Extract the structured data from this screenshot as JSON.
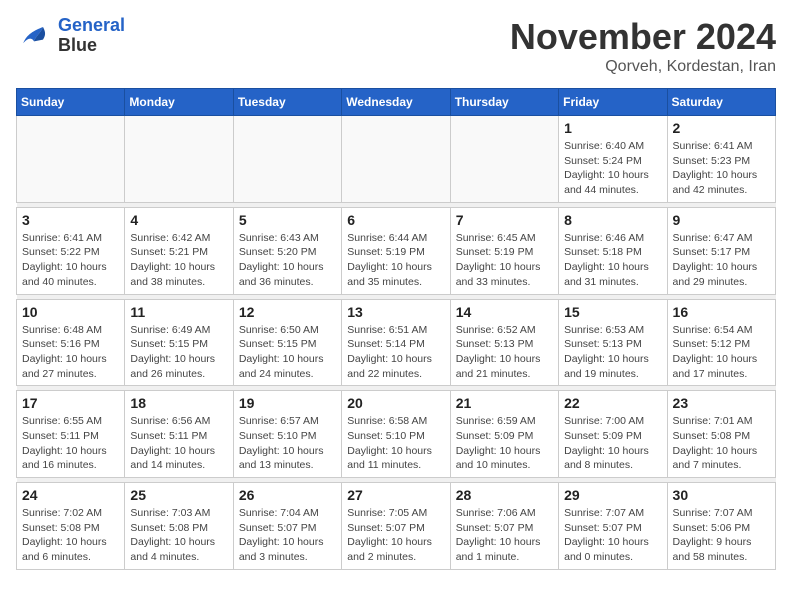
{
  "header": {
    "logo_line1": "General",
    "logo_line2": "Blue",
    "month": "November 2024",
    "location": "Qorveh, Kordestan, Iran"
  },
  "weekdays": [
    "Sunday",
    "Monday",
    "Tuesday",
    "Wednesday",
    "Thursday",
    "Friday",
    "Saturday"
  ],
  "weeks": [
    [
      {
        "day": "",
        "info": ""
      },
      {
        "day": "",
        "info": ""
      },
      {
        "day": "",
        "info": ""
      },
      {
        "day": "",
        "info": ""
      },
      {
        "day": "",
        "info": ""
      },
      {
        "day": "1",
        "info": "Sunrise: 6:40 AM\nSunset: 5:24 PM\nDaylight: 10 hours\nand 44 minutes."
      },
      {
        "day": "2",
        "info": "Sunrise: 6:41 AM\nSunset: 5:23 PM\nDaylight: 10 hours\nand 42 minutes."
      }
    ],
    [
      {
        "day": "3",
        "info": "Sunrise: 6:41 AM\nSunset: 5:22 PM\nDaylight: 10 hours\nand 40 minutes."
      },
      {
        "day": "4",
        "info": "Sunrise: 6:42 AM\nSunset: 5:21 PM\nDaylight: 10 hours\nand 38 minutes."
      },
      {
        "day": "5",
        "info": "Sunrise: 6:43 AM\nSunset: 5:20 PM\nDaylight: 10 hours\nand 36 minutes."
      },
      {
        "day": "6",
        "info": "Sunrise: 6:44 AM\nSunset: 5:19 PM\nDaylight: 10 hours\nand 35 minutes."
      },
      {
        "day": "7",
        "info": "Sunrise: 6:45 AM\nSunset: 5:19 PM\nDaylight: 10 hours\nand 33 minutes."
      },
      {
        "day": "8",
        "info": "Sunrise: 6:46 AM\nSunset: 5:18 PM\nDaylight: 10 hours\nand 31 minutes."
      },
      {
        "day": "9",
        "info": "Sunrise: 6:47 AM\nSunset: 5:17 PM\nDaylight: 10 hours\nand 29 minutes."
      }
    ],
    [
      {
        "day": "10",
        "info": "Sunrise: 6:48 AM\nSunset: 5:16 PM\nDaylight: 10 hours\nand 27 minutes."
      },
      {
        "day": "11",
        "info": "Sunrise: 6:49 AM\nSunset: 5:15 PM\nDaylight: 10 hours\nand 26 minutes."
      },
      {
        "day": "12",
        "info": "Sunrise: 6:50 AM\nSunset: 5:15 PM\nDaylight: 10 hours\nand 24 minutes."
      },
      {
        "day": "13",
        "info": "Sunrise: 6:51 AM\nSunset: 5:14 PM\nDaylight: 10 hours\nand 22 minutes."
      },
      {
        "day": "14",
        "info": "Sunrise: 6:52 AM\nSunset: 5:13 PM\nDaylight: 10 hours\nand 21 minutes."
      },
      {
        "day": "15",
        "info": "Sunrise: 6:53 AM\nSunset: 5:13 PM\nDaylight: 10 hours\nand 19 minutes."
      },
      {
        "day": "16",
        "info": "Sunrise: 6:54 AM\nSunset: 5:12 PM\nDaylight: 10 hours\nand 17 minutes."
      }
    ],
    [
      {
        "day": "17",
        "info": "Sunrise: 6:55 AM\nSunset: 5:11 PM\nDaylight: 10 hours\nand 16 minutes."
      },
      {
        "day": "18",
        "info": "Sunrise: 6:56 AM\nSunset: 5:11 PM\nDaylight: 10 hours\nand 14 minutes."
      },
      {
        "day": "19",
        "info": "Sunrise: 6:57 AM\nSunset: 5:10 PM\nDaylight: 10 hours\nand 13 minutes."
      },
      {
        "day": "20",
        "info": "Sunrise: 6:58 AM\nSunset: 5:10 PM\nDaylight: 10 hours\nand 11 minutes."
      },
      {
        "day": "21",
        "info": "Sunrise: 6:59 AM\nSunset: 5:09 PM\nDaylight: 10 hours\nand 10 minutes."
      },
      {
        "day": "22",
        "info": "Sunrise: 7:00 AM\nSunset: 5:09 PM\nDaylight: 10 hours\nand 8 minutes."
      },
      {
        "day": "23",
        "info": "Sunrise: 7:01 AM\nSunset: 5:08 PM\nDaylight: 10 hours\nand 7 minutes."
      }
    ],
    [
      {
        "day": "24",
        "info": "Sunrise: 7:02 AM\nSunset: 5:08 PM\nDaylight: 10 hours\nand 6 minutes."
      },
      {
        "day": "25",
        "info": "Sunrise: 7:03 AM\nSunset: 5:08 PM\nDaylight: 10 hours\nand 4 minutes."
      },
      {
        "day": "26",
        "info": "Sunrise: 7:04 AM\nSunset: 5:07 PM\nDaylight: 10 hours\nand 3 minutes."
      },
      {
        "day": "27",
        "info": "Sunrise: 7:05 AM\nSunset: 5:07 PM\nDaylight: 10 hours\nand 2 minutes."
      },
      {
        "day": "28",
        "info": "Sunrise: 7:06 AM\nSunset: 5:07 PM\nDaylight: 10 hours\nand 1 minute."
      },
      {
        "day": "29",
        "info": "Sunrise: 7:07 AM\nSunset: 5:07 PM\nDaylight: 10 hours\nand 0 minutes."
      },
      {
        "day": "30",
        "info": "Sunrise: 7:07 AM\nSunset: 5:06 PM\nDaylight: 9 hours\nand 58 minutes."
      }
    ]
  ]
}
